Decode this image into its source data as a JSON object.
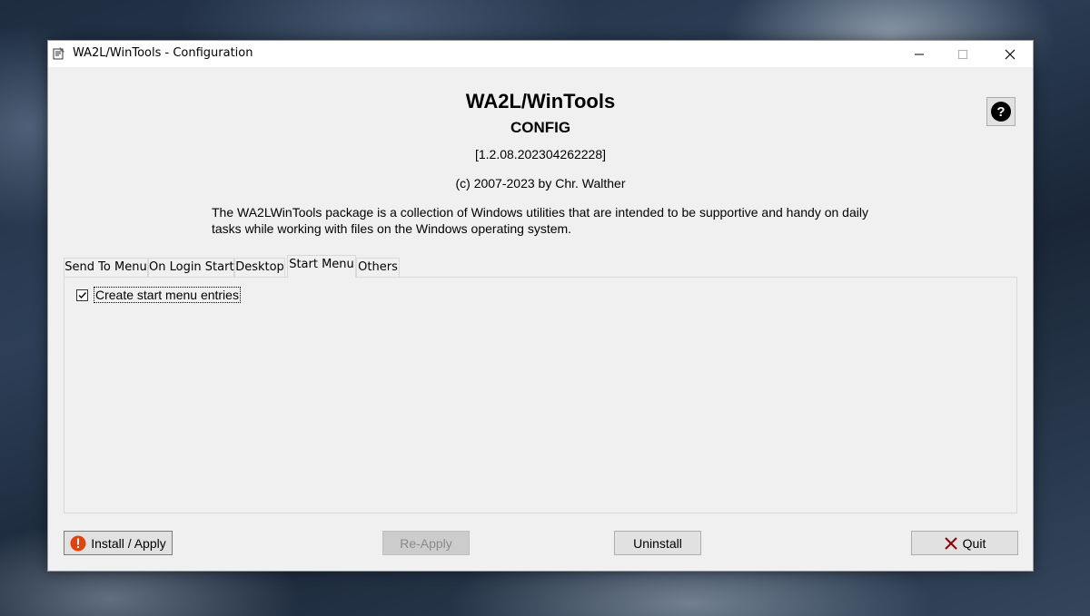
{
  "window": {
    "title": "WA2L/WinTools - Configuration"
  },
  "header": {
    "title": "WA2L/WinTools",
    "subtitle": "CONFIG",
    "version": "[1.2.08.202304262228]",
    "copyright": "(c) 2007-2023 by Chr. Walther",
    "description": "The WA2LWinTools package is a collection of Windows utilities that are intended to be supportive and handy on daily tasks while working with files on the Windows operating system."
  },
  "help": {
    "label": "?"
  },
  "tabs": [
    {
      "label": "Send To Menu"
    },
    {
      "label": "On Login Start"
    },
    {
      "label": "Desktop"
    },
    {
      "label": "Start Menu"
    },
    {
      "label": "Others"
    }
  ],
  "active_tab": "Start Menu",
  "panel": {
    "checkbox_label": "Create start menu entries",
    "checkbox_checked": true
  },
  "buttons": {
    "install": "Install / Apply",
    "reapply": "Re-Apply",
    "uninstall": "Uninstall",
    "quit": "Quit"
  },
  "colors": {
    "warning_icon": "#e0440e",
    "quit_icon": "#8b0000"
  }
}
